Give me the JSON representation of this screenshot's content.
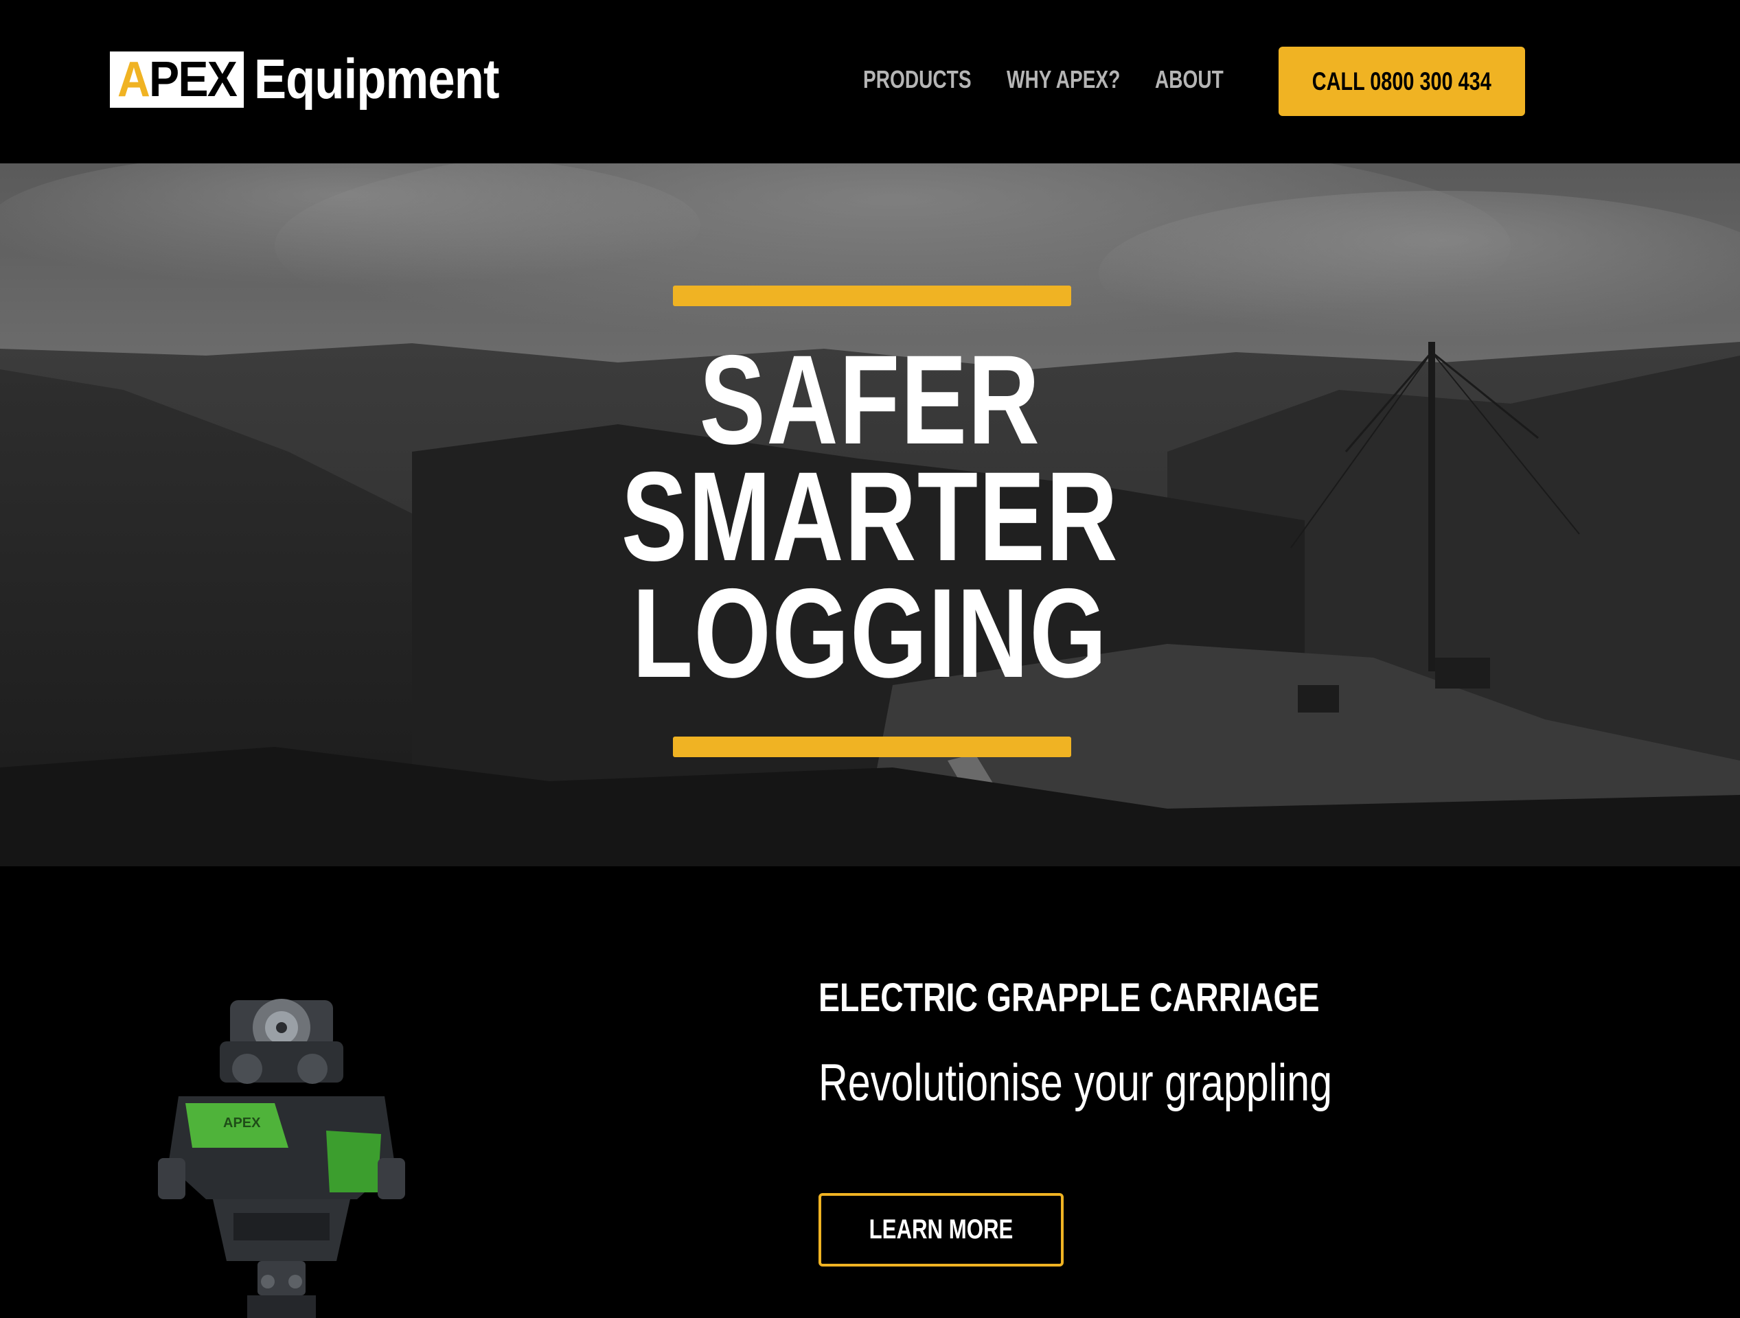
{
  "brand": {
    "logo_mark_prefix": "A",
    "logo_mark_rest": "PEX",
    "logo_word": "Equipment",
    "accent_color": "#f0b323"
  },
  "nav": {
    "items": [
      {
        "label": "PRODUCTS"
      },
      {
        "label": "WHY APEX?"
      },
      {
        "label": "ABOUT"
      }
    ],
    "cta_label": "CALL 0800 300 434"
  },
  "hero": {
    "lines": [
      "SAFER",
      "SMARTER",
      "LOGGING"
    ],
    "image_subject": "black-and-white forestry hillside with cable logging tower"
  },
  "feature": {
    "kicker": "ELECTRIC GRAPPLE CARRIAGE",
    "tagline": "Revolutionise your grappling",
    "button_label": "LEARN MORE",
    "product_badge": "APEX",
    "product_color": "#4fb33a"
  }
}
